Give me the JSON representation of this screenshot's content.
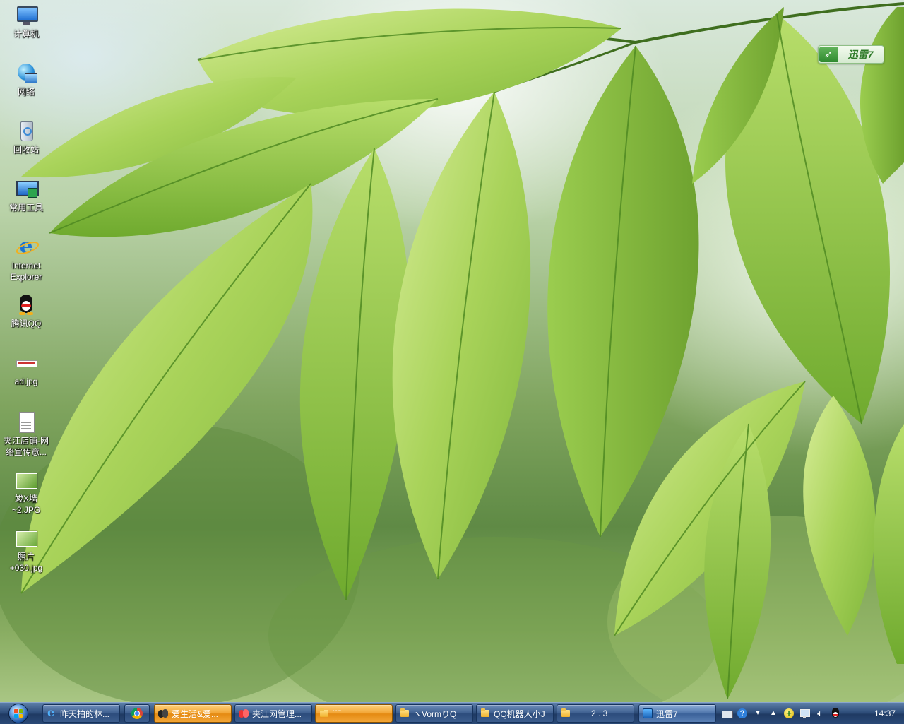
{
  "desktop": {
    "icons": [
      {
        "label": "计算机",
        "icon": "computer-icon"
      },
      {
        "label": "网络",
        "icon": "network-icon"
      },
      {
        "label": "回收站",
        "icon": "recycle-bin-icon"
      },
      {
        "label": "常用工具",
        "icon": "tools-icon"
      },
      {
        "label": "Internet\nExplorer",
        "icon": "ie-icon"
      },
      {
        "label": "腾讯QQ",
        "icon": "qq-icon"
      },
      {
        "label": "ad.jpg",
        "icon": "image-file-icon"
      },
      {
        "label": "夹江店铺-网\n络宣传意...",
        "icon": "document-icon"
      },
      {
        "label": "竣X墙\n~2.JPG",
        "icon": "image-thumb-icon"
      },
      {
        "label": "照片\n+030.jpg",
        "icon": "image-thumb-icon"
      }
    ],
    "xunlei_float": {
      "label": "迅雷7",
      "icon": "xunlei-bird-icon"
    }
  },
  "taskbar": {
    "tasks": [
      {
        "label": "昨天拍的林...",
        "icon": "ie-icon",
        "state": "normal"
      },
      {
        "label": "",
        "icon": "chrome-icon",
        "state": "normal"
      },
      {
        "label": "爱生活&爱...",
        "icon": "qq-group-icon",
        "state": "highlight"
      },
      {
        "label": "夹江网管理...",
        "icon": "qq-group-icon",
        "state": "normal"
      },
      {
        "label": "˜˜˜",
        "icon": "folder-icon",
        "state": "highlight"
      },
      {
        "label": "ヽVormりQ",
        "icon": "folder-icon",
        "state": "normal"
      },
      {
        "label": "QQ机器人小J",
        "icon": "folder-icon",
        "state": "normal"
      },
      {
        "label": "2 . 3",
        "icon": "folder-icon",
        "state": "normal"
      },
      {
        "label": "迅雷7",
        "icon": "xunlei-icon",
        "state": "active"
      }
    ],
    "tray": {
      "icons": [
        "keyboard-icon",
        "help-icon",
        "chevron-down-icon",
        "show-hidden-icon",
        "add-icon",
        "network-tray-icon",
        "volume-icon",
        "qq-tray-icon"
      ],
      "clock": "14:37"
    }
  }
}
